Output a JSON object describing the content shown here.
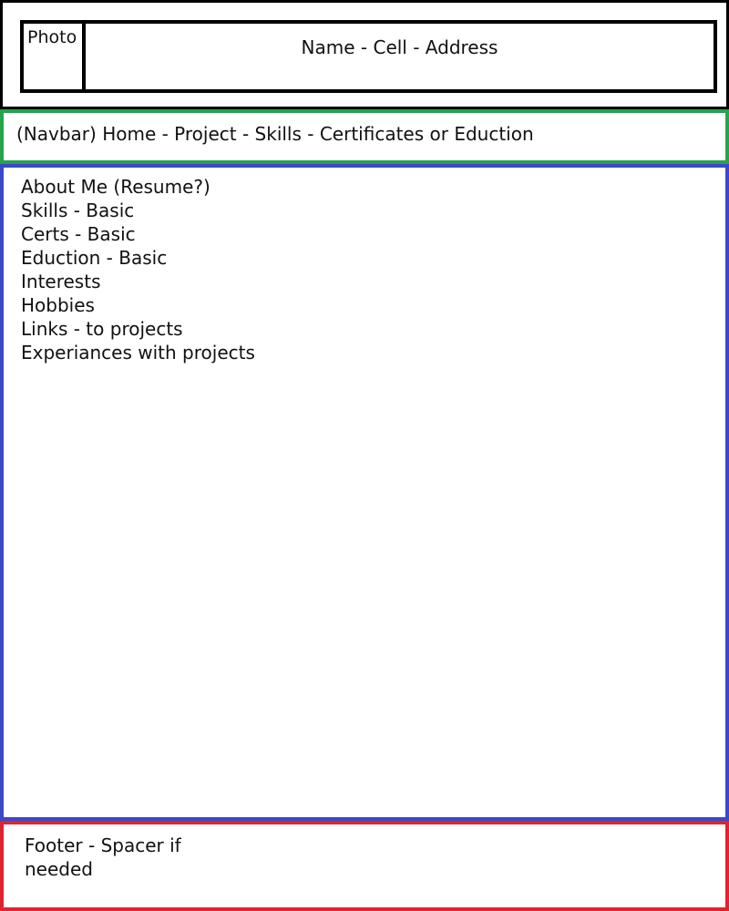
{
  "header": {
    "photo_label": "Photo",
    "contact_line": "Name - Cell - Address"
  },
  "navbar": {
    "text": "(Navbar) Home - Project - Skills - Certificates or Eduction"
  },
  "main": {
    "items": [
      "About Me (Resume?)",
      "Skills - Basic",
      "Certs - Basic",
      "Eduction - Basic",
      "Interests",
      "Hobbies",
      "Links - to projects",
      "Experiances with projects"
    ]
  },
  "footer": {
    "text": "Footer - Spacer if needed"
  },
  "colors": {
    "header_border": "#000000",
    "navbar_border": "#27a34c",
    "main_border": "#3b48c9",
    "footer_border": "#e0242f"
  }
}
